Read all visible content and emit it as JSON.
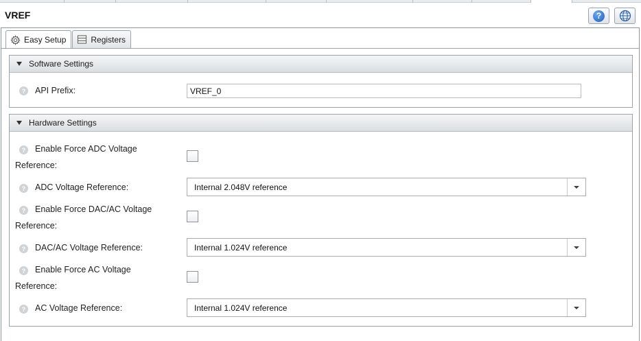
{
  "window": {
    "title": "VREF"
  },
  "header": {
    "help_icon": "help-icon",
    "web_icon": "globe-icon",
    "help_glyph": "?"
  },
  "tabs": [
    {
      "label": "Easy Setup",
      "icon": "gear-icon",
      "active": true
    },
    {
      "label": "Registers",
      "icon": "register-list-icon",
      "active": false
    }
  ],
  "software_settings": {
    "title": "Software Settings",
    "api_prefix": {
      "label": "API Prefix:",
      "value": "VREF_0"
    }
  },
  "hardware_settings": {
    "title": "Hardware Settings",
    "force_adc": {
      "label_line1": "Enable Force ADC Voltage",
      "label_line2": "Reference:",
      "checked": false
    },
    "adc_ref": {
      "label": "ADC Voltage Reference:",
      "value": "Internal 2.048V reference"
    },
    "force_dac": {
      "label_line1": "Enable Force DAC/AC Voltage",
      "label_line2": "Reference:",
      "checked": false
    },
    "dac_ref": {
      "label": "DAC/AC Voltage Reference:",
      "value": "Internal 1.024V reference"
    },
    "force_ac": {
      "label_line1": "Enable Force AC Voltage",
      "label_line2": "Reference:",
      "checked": false
    },
    "ac_ref": {
      "label": "AC Voltage Reference:",
      "value": "Internal 1.024V reference"
    }
  },
  "help_glyph": "?"
}
